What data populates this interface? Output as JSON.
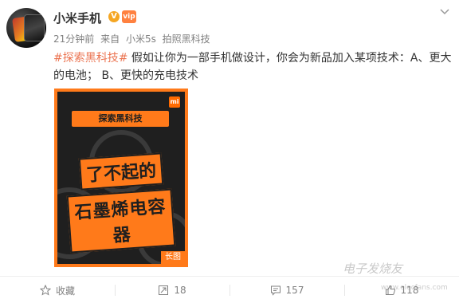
{
  "post": {
    "author": "小米手机",
    "verified_mark": "V",
    "vip_mark": "vip",
    "meta": {
      "time": "21分钟前",
      "source_prefix": "来自",
      "source_device": "小米5s",
      "source_feature": "拍照黑科技"
    },
    "topic": "#探索黑科技#",
    "text": " 假如让你为一部手机做设计，你会为新品加入某项技术：A、更大的电池； B、更快的充电技术"
  },
  "poster": {
    "logo": "mi",
    "tag": "探索黑科技",
    "headline_line1": "了不起的",
    "headline_line2": "石墨烯电容器",
    "long_image_badge": "长图"
  },
  "actions": {
    "favorite_label": "收藏",
    "forward_count": "18",
    "comment_count": "157",
    "like_count": "118"
  },
  "watermark": {
    "text": "电子发烧友",
    "url": "www.elecfans.com"
  },
  "colors": {
    "topic": "#eb7350",
    "poster_orange": "#ff7a1a",
    "poster_bg": "#1f1f1f"
  }
}
